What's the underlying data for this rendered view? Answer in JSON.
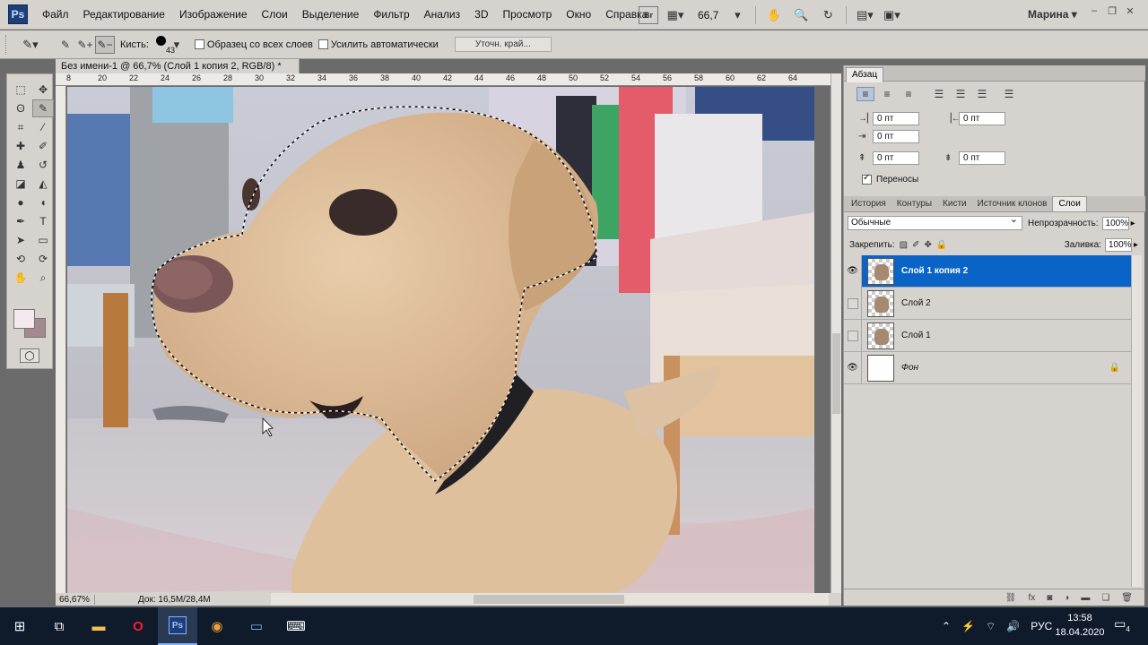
{
  "app": {
    "logo": "Ps",
    "menu": [
      "Файл",
      "Редактирование",
      "Изображение",
      "Слои",
      "Выделение",
      "Фильтр",
      "Анализ",
      "3D",
      "Просмотр",
      "Окно",
      "Справка"
    ],
    "bridge_label": "Br",
    "zoom": "66,7",
    "user": "Марина"
  },
  "options": {
    "brush_label": "Кисть:",
    "brush_size": "43",
    "sample_all_layers": "Образец со всех слоев",
    "auto_enhance": "Усилить автоматически",
    "refine_edge": "Уточн. край..."
  },
  "document": {
    "tab_title": "Без имени-1 @ 66,7% (Слой 1 копия 2, RGB/8) *",
    "ruler_ticks": [
      "8",
      "20",
      "22",
      "24",
      "26",
      "28",
      "30",
      "32",
      "34",
      "36",
      "38",
      "40",
      "42",
      "44",
      "46",
      "48",
      "50",
      "52",
      "54",
      "56",
      "58",
      "60",
      "62",
      "64"
    ],
    "zoom_status": "66,67%",
    "doc_info": "Док: 16,5M/28,4M"
  },
  "paragraph_panel": {
    "tab": "Абзац",
    "indent_left": "0 пт",
    "indent_right": "0 пт",
    "indent_first": "0 пт",
    "space_before": "0 пт",
    "space_after": "0 пт",
    "hyphenation": "Переносы"
  },
  "layers_panel": {
    "tabs": [
      "История",
      "Контуры",
      "Кисти",
      "Источник клонов",
      "Слои"
    ],
    "active_tab": "Слои",
    "blend_mode": "Обычные",
    "opacity_label": "Непрозрачность:",
    "opacity": "100%",
    "lock_label": "Закрепить:",
    "fill_label": "Заливка:",
    "fill": "100%",
    "layers": [
      {
        "name": "Слой 1 копия 2",
        "visible": true,
        "selected": true
      },
      {
        "name": "Слой 2",
        "visible": false,
        "selected": false
      },
      {
        "name": "Слой 1",
        "visible": false,
        "selected": false
      },
      {
        "name": "Фон",
        "visible": true,
        "selected": false,
        "locked": true
      }
    ]
  },
  "taskbar": {
    "language": "РУС",
    "time": "13:58",
    "date": "18.04.2020",
    "notifications": "4"
  },
  "colors": {
    "selection_blue": "#0a64c8",
    "foreground": "#f5e8ee",
    "background": "#a4898e"
  }
}
